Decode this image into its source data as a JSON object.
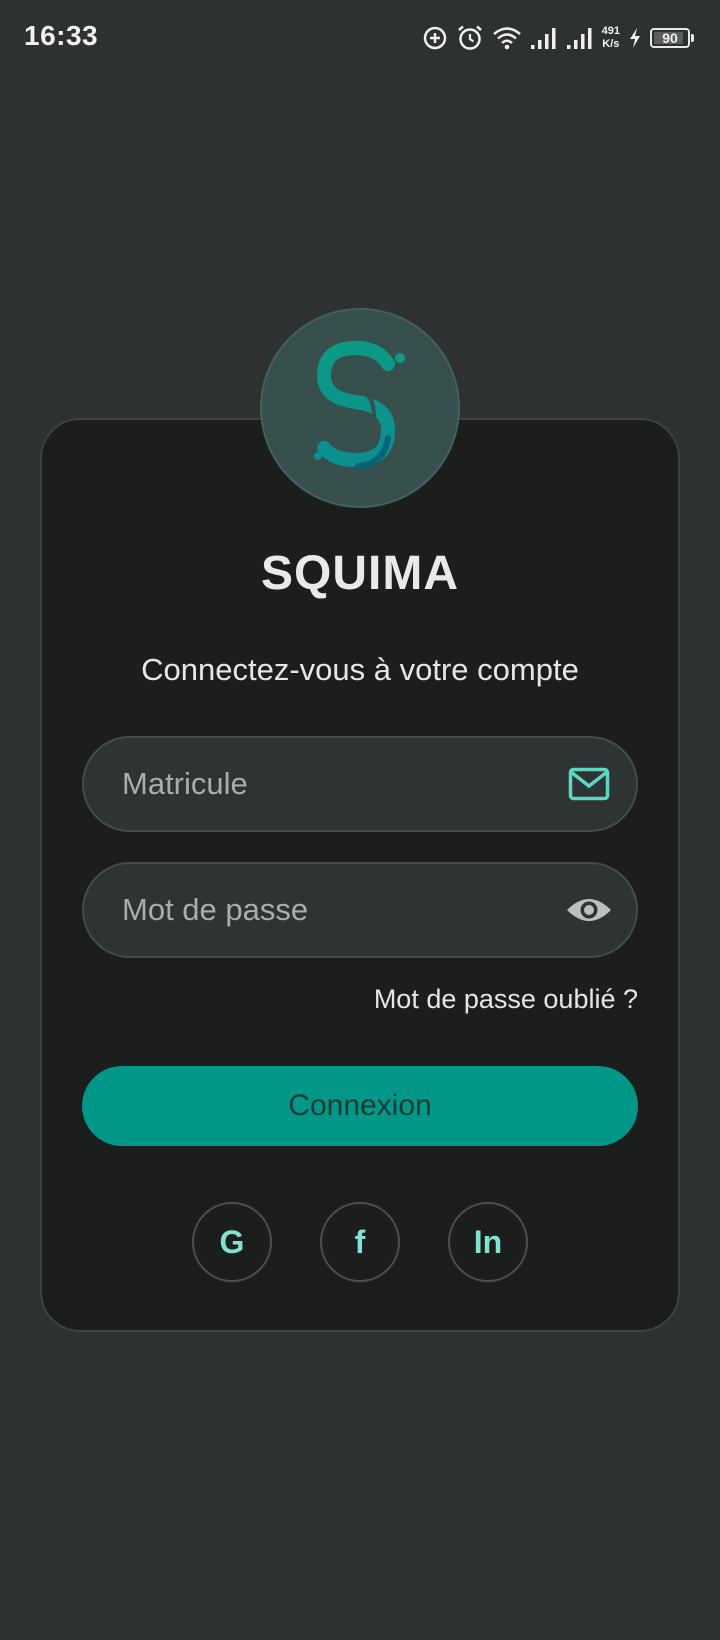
{
  "status_bar": {
    "time": "16:33",
    "net_speed_value": "491",
    "net_speed_unit": "K/s",
    "battery_level": "90",
    "icons": [
      "data-saver-icon",
      "alarm-icon",
      "wifi-icon",
      "signal-icon",
      "signal-icon",
      "charging-icon",
      "battery-icon"
    ]
  },
  "app": {
    "title": "SQUIMA",
    "subtitle": "Connectez-vous à votre compte",
    "logo_icon": "squima-logo-icon"
  },
  "form": {
    "matricule_placeholder": "Matricule",
    "matricule_icon": "mail-icon",
    "password_placeholder": "Mot de passe",
    "password_icon": "eye-icon",
    "forgot_label": "Mot de passe oublié ?",
    "submit_label": "Connexion"
  },
  "social": {
    "google_label": "G",
    "facebook_label": "f",
    "linkedin_label": "In"
  },
  "colors": {
    "background": "#2d3132",
    "card": "#1c1e1e",
    "accent": "#009688",
    "icon_accent": "#5ed6c4"
  }
}
